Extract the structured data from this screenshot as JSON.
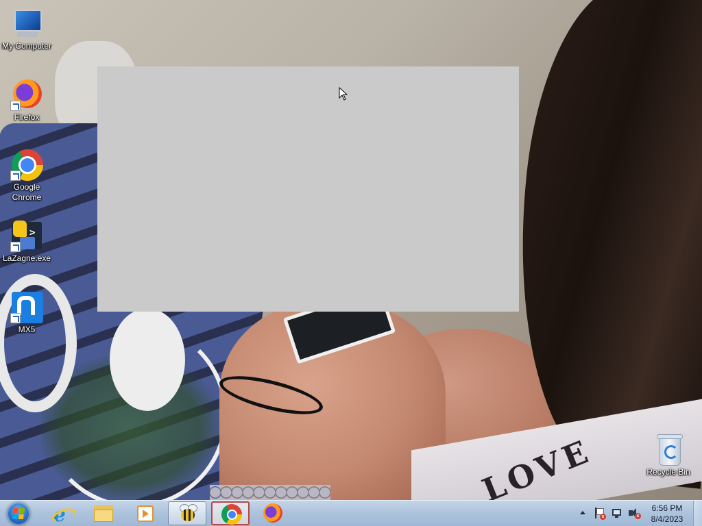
{
  "desktop": {
    "icons": [
      {
        "label": "My Computer",
        "icon": "computer-icon"
      },
      {
        "label": "Firefox",
        "icon": "firefox-icon"
      },
      {
        "label": "Google Chrome",
        "icon": "chrome-icon"
      },
      {
        "label": "LaZagne.exe",
        "icon": "lazagne-icon"
      },
      {
        "label": "MX5",
        "icon": "maxthon-icon"
      },
      {
        "label": "Recycle Bin",
        "icon": "recycle-bin-icon"
      }
    ],
    "wallpaper_text": "LOVE",
    "blank_window_color": "#cacaca"
  },
  "taskbar": {
    "start": {
      "icon": "windows-start-orb-icon"
    },
    "pinned": [
      {
        "name": "internet-explorer",
        "icon": "internet-explorer-icon"
      },
      {
        "name": "file-explorer",
        "icon": "folder-icon"
      },
      {
        "name": "media-player",
        "icon": "media-player-icon"
      },
      {
        "name": "bee-app",
        "icon": "bee-icon",
        "state": "active"
      },
      {
        "name": "google-chrome",
        "icon": "chrome-icon",
        "state": "pressed"
      },
      {
        "name": "firefox",
        "icon": "firefox-icon"
      }
    ],
    "tray": {
      "icons": [
        "show-hidden-icons-arrow-icon",
        "action-center-flag-icon",
        "network-icon",
        "volume-muted-icon"
      ],
      "time": "6:56 PM",
      "date": "8/4/2023"
    },
    "colors": {
      "taskbar": "#aec4dd",
      "pressed_border": "#b34a4a"
    }
  }
}
